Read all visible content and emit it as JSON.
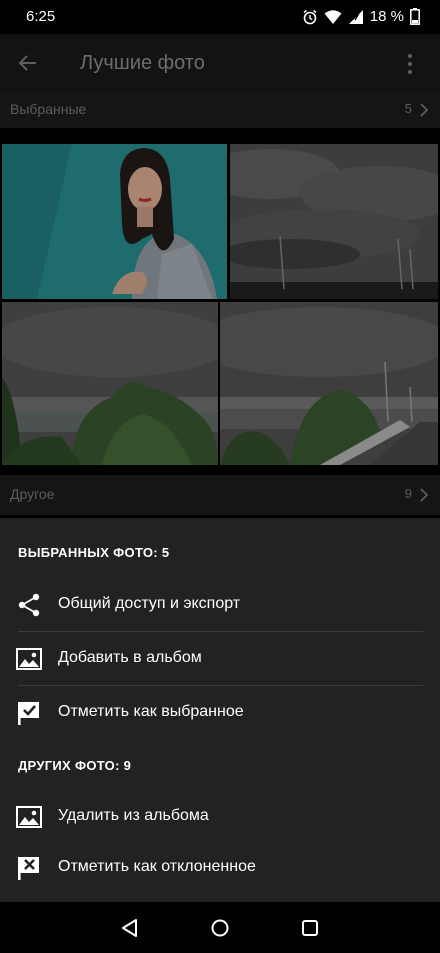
{
  "status": {
    "time": "6:25",
    "battery": "18 %"
  },
  "app_bar": {
    "title": "Лучшие фото"
  },
  "sections": {
    "selected": {
      "label": "Выбранные",
      "count": "5"
    },
    "other": {
      "label": "Другое",
      "count": "9"
    }
  },
  "photos": [
    {
      "name": "portrait-photo",
      "subject": "woman portrait on teal background"
    },
    {
      "name": "storm-clouds-photo",
      "subject": "dark storm clouds over road"
    },
    {
      "name": "trees-river-photo",
      "subject": "trees by river under cloudy sky"
    },
    {
      "name": "highway-clouds-photo",
      "subject": "highway with guard rail under clouds"
    }
  ],
  "sheet": {
    "selected_heading": "ВЫБРАННЫХ ФОТО: 5",
    "other_heading": "ДРУГИХ ФОТО: 9",
    "items": [
      {
        "label": "Общий доступ и экспорт",
        "icon": "share-icon"
      },
      {
        "label": "Добавить в альбом",
        "icon": "image-icon"
      },
      {
        "label": "Отметить как выбранное",
        "icon": "flag-check-icon"
      },
      {
        "label": "Удалить из альбома",
        "icon": "image-icon"
      },
      {
        "label": "Отметить как отклоненное",
        "icon": "flag-x-icon"
      }
    ]
  },
  "colors": {
    "background": "#000000",
    "sheet": "#222222",
    "teal_photo": "#1e6c6e"
  }
}
